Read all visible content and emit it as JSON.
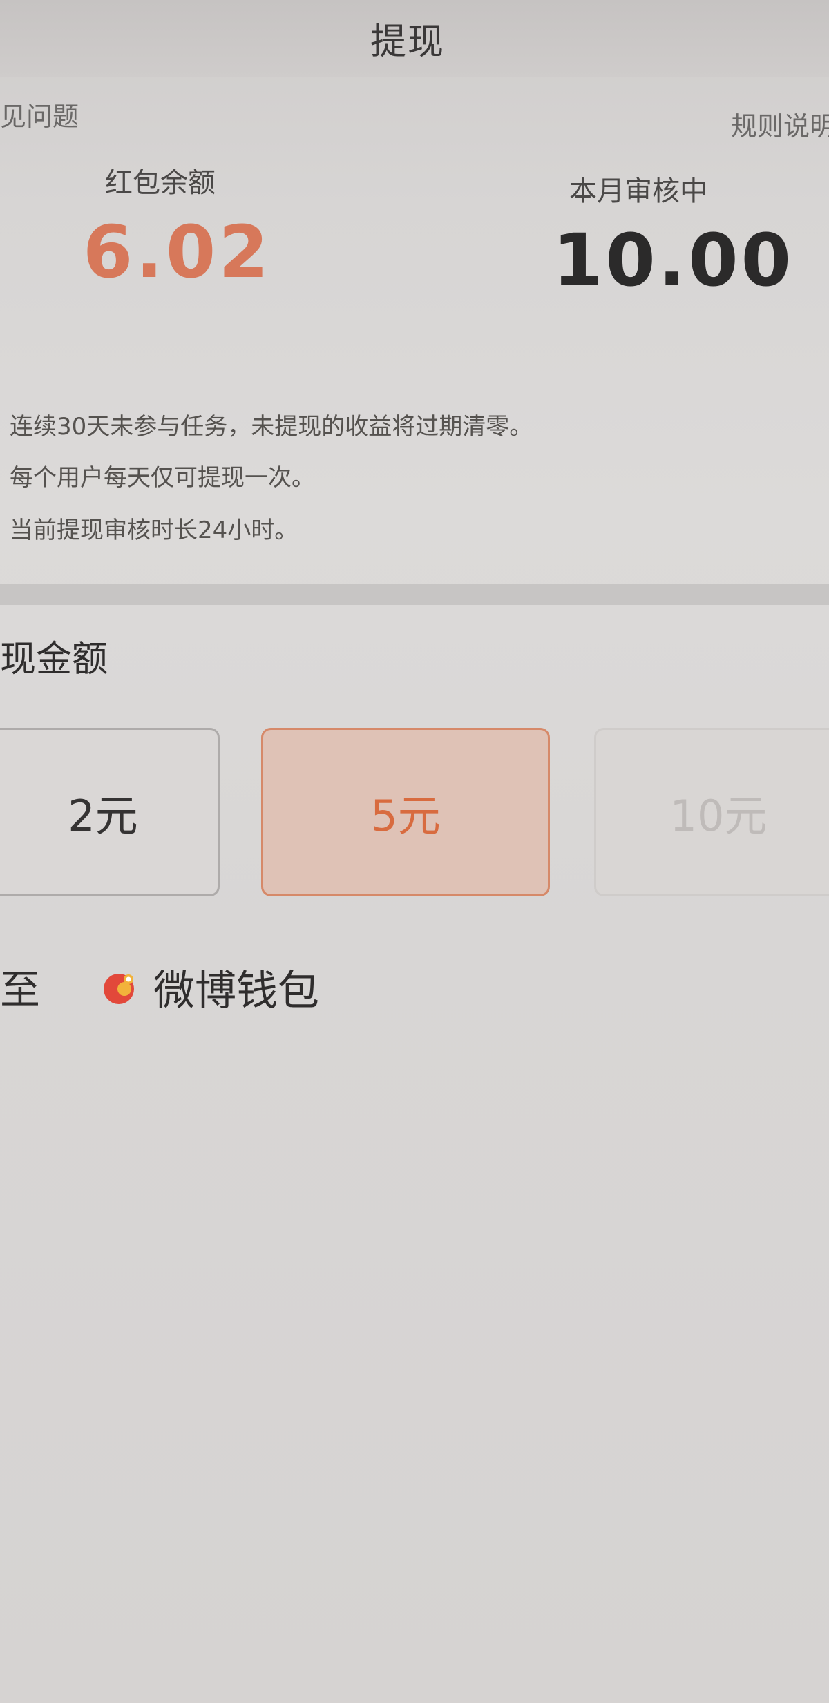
{
  "header": {
    "title": "提现"
  },
  "links": {
    "faq": "见问题",
    "rules": "规则说明"
  },
  "stats": {
    "balance": {
      "label": "红包余额",
      "value": "6.02"
    },
    "review": {
      "label": "本月审核中",
      "value": "10.00"
    }
  },
  "notices": [
    "连续30天未参与任务，未提现的收益将过期清零。",
    "每个用户每天仅可提现一次。",
    "当前提现审核时长24小时。"
  ],
  "amount_section": {
    "title": "现金额",
    "options": [
      {
        "label": "2元",
        "state": "normal"
      },
      {
        "label": "5元",
        "state": "selected"
      },
      {
        "label": "10元",
        "state": "disabled"
      }
    ]
  },
  "destination": {
    "prefix": "至",
    "wallet_label": "微博钱包",
    "wallet_icon": "weibo-wallet-icon"
  },
  "colors": {
    "accent": "#d86b3f",
    "balance": "#d7785a",
    "text": "#2f2d2d"
  }
}
